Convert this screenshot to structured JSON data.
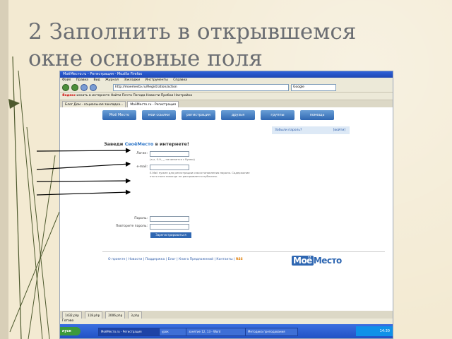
{
  "slide": {
    "title_line1": "2 Заполнить в открывшемся",
    "title_line2": "окне основные поля"
  },
  "browser": {
    "window_title": "МоёМесто.ru - Регистрация - Mozilla Firefox",
    "menu": [
      "Файл",
      "Правка",
      "Вид",
      "Журнал",
      "Закладки",
      "Инструменты",
      "Справка"
    ],
    "address": "http://moemesto.ru/Registration/action",
    "search_placeholder": "Google",
    "toolbar2_brand": "Яндекс",
    "toolbar2_text": "искать в интернете   Найти   Почта   Погода   Новости   Пробки   Настройка",
    "tabs": [
      {
        "label": "Блог Дом - социальная закладка...",
        "active": false
      },
      {
        "label": "МоёМесто.ru - Регистрация",
        "active": true
      }
    ]
  },
  "site": {
    "nav": [
      "Моё Место",
      "мои ссылки",
      "регистрация",
      "друзья",
      "группы",
      "помощь"
    ],
    "forgot_text": "Забыли пароль?",
    "forgot_link": "[войти]",
    "heading_prefix": "Заведи",
    "heading_brand": "СвоёМесто",
    "heading_suffix": "в интернете!",
    "login_label": "Логин:",
    "login_hint": "(a-z, 0-9, _, начинается с буквы)",
    "email_label": "e-mail:",
    "email_hint": "Е-Mail нужен для регистрации и восстановления пароля. Содержание этого поля никогда не раскрывается публично.",
    "password_label": "Пароль:",
    "password_repeat_label": "Повторите пароль:",
    "submit_label": "Зарегистрироваться",
    "footer_links": "О проекте | Новости | Поддержка | Блог | Книга Предложений | Контакты |",
    "rss": "RSS",
    "logo_part1": "Моё",
    "logo_part2": "Место"
  },
  "downloads": [
    "1432.php",
    "118.php",
    "2006.php",
    "3.php"
  ],
  "status": "Готово",
  "taskbar": {
    "start": "пуск",
    "tasks": [
      {
        "label": "МоёМесто.ru - Регистрация",
        "active": true
      },
      {
        "label": "урок",
        "active": false
      },
      {
        "label": "занятие 12, 13 - Word",
        "active": false
      },
      {
        "label": "Методика преподавания",
        "active": false
      }
    ],
    "clock": "14:30"
  },
  "colors": {
    "slide_bg": "#f3ead2",
    "title_color": "#6b6e73",
    "site_blue": "#2f67b2"
  }
}
